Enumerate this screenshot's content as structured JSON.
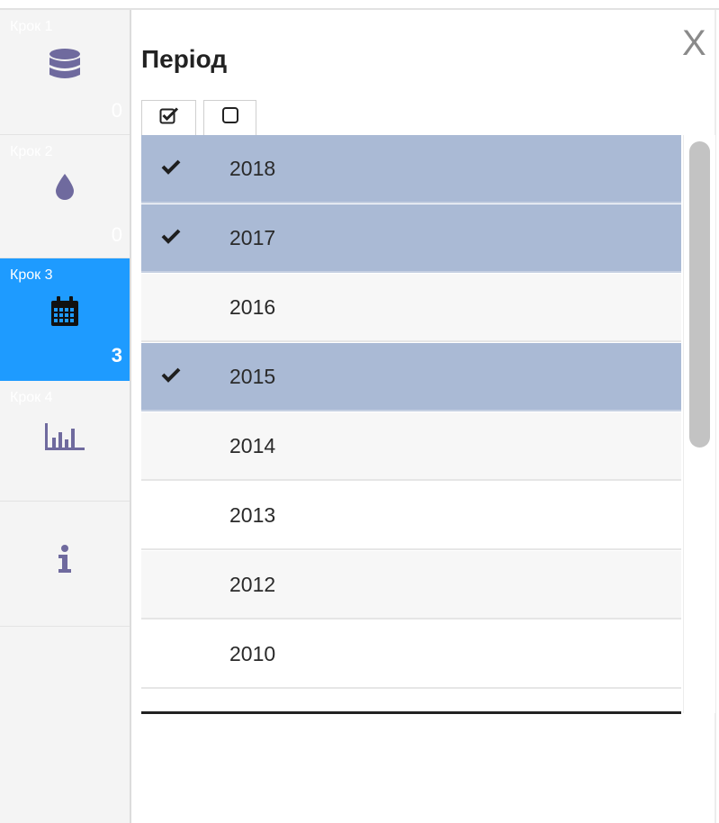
{
  "panel": {
    "title": "Період",
    "close_label": "X"
  },
  "steps": [
    {
      "label": "Крок 1",
      "count": "0",
      "icon": "database-icon",
      "active": false
    },
    {
      "label": "Крок 2",
      "count": "0",
      "icon": "drop-icon",
      "active": false
    },
    {
      "label": "Крок 3",
      "count": "3",
      "icon": "calendar-icon",
      "active": true
    },
    {
      "label": "Крок 4",
      "count": "",
      "icon": "bar-chart-icon",
      "active": false
    },
    {
      "label": "",
      "count": "",
      "icon": "info-icon",
      "active": false
    }
  ],
  "toolbar": {
    "select_all_icon": "checked-square-icon",
    "select_none_icon": "empty-square-icon"
  },
  "years": [
    {
      "year": "2018",
      "selected": true
    },
    {
      "year": "2017",
      "selected": true
    },
    {
      "year": "2016",
      "selected": false
    },
    {
      "year": "2015",
      "selected": true
    },
    {
      "year": "2014",
      "selected": false
    },
    {
      "year": "2013",
      "selected": false
    },
    {
      "year": "2012",
      "selected": false
    },
    {
      "year": "2010",
      "selected": false
    }
  ],
  "colors": {
    "active_step": "#1e9bff",
    "selected_row": "#aabad5",
    "icon": "#6f6a9e"
  }
}
